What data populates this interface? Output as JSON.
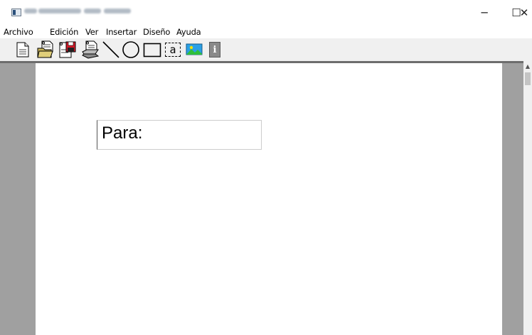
{
  "window": {
    "title": "",
    "controls": {
      "minimize": "─",
      "maximize": "☐",
      "close": "✕"
    }
  },
  "menu": {
    "items": [
      "Archivo",
      "Edición",
      "Ver",
      "Insertar",
      "Diseño",
      "Ayuda"
    ]
  },
  "toolbar": {
    "buttons": [
      {
        "icon": "new-document-icon"
      },
      {
        "icon": "open-folder-icon"
      },
      {
        "icon": "save-disk-icon"
      },
      {
        "icon": "print-icon"
      },
      {
        "icon": "line-tool-icon"
      },
      {
        "icon": "ellipse-tool-icon"
      },
      {
        "icon": "rectangle-tool-icon"
      },
      {
        "icon": "text-tool-icon",
        "glyph": "a"
      },
      {
        "icon": "image-tool-icon"
      },
      {
        "icon": "info-icon",
        "glyph": "i"
      }
    ]
  },
  "document": {
    "textbox_label": "Para:"
  },
  "colors": {
    "workspace": "#a0a0a0",
    "paper": "#ffffff",
    "toolbar": "#f0f0f0"
  }
}
